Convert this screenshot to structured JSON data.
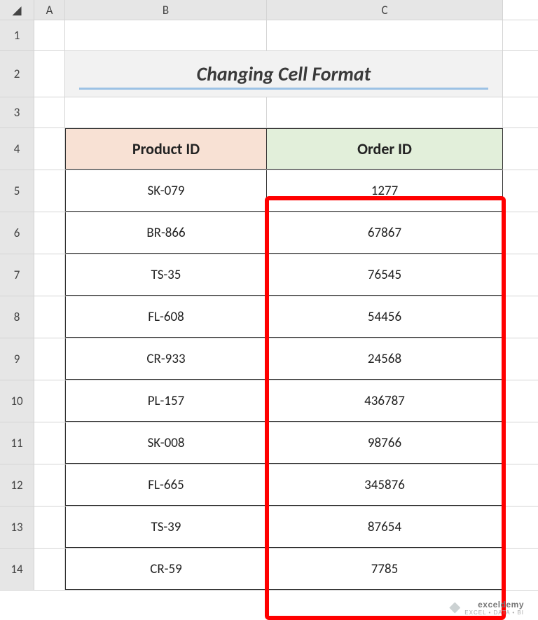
{
  "columns": {
    "corner": "◢",
    "a": "A",
    "b": "B",
    "c": "C"
  },
  "row_headers": [
    "1",
    "2",
    "3",
    "4",
    "5",
    "6",
    "7",
    "8",
    "9",
    "10",
    "11",
    "12",
    "13",
    "14"
  ],
  "title": "Changing Cell Format",
  "headers": {
    "product": "Product ID",
    "order": "Order ID"
  },
  "rows": [
    {
      "product": "SK-079",
      "order": "1277"
    },
    {
      "product": "BR-866",
      "order": "67867"
    },
    {
      "product": "TS-35",
      "order": "76545"
    },
    {
      "product": "FL-608",
      "order": "54456"
    },
    {
      "product": "CR-933",
      "order": "24568"
    },
    {
      "product": "PL-157",
      "order": "436787"
    },
    {
      "product": "SK-008",
      "order": "98766"
    },
    {
      "product": "FL-665",
      "order": "345876"
    },
    {
      "product": "TS-39",
      "order": "87654"
    },
    {
      "product": "CR-59",
      "order": "7785"
    }
  ],
  "watermark": {
    "brand": "exceldemy",
    "tagline": "EXCEL • DATA • BI"
  }
}
